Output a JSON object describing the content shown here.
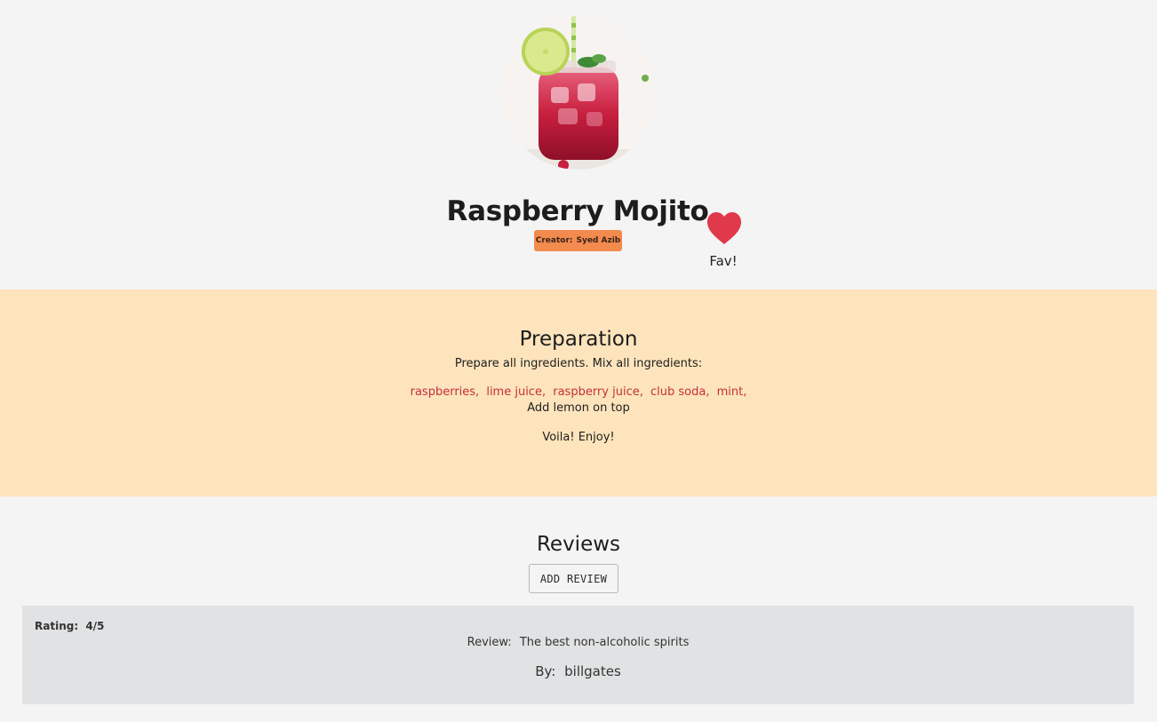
{
  "recipe": {
    "image_alt": "raspberry mojito drink in a jar",
    "title": "Raspberry Mojito",
    "creator_label": "Creator:",
    "creator_name": "Syed Azib",
    "fav_icon": "heart-icon",
    "fav_label": "Fav!"
  },
  "preparation": {
    "heading": "Preparation",
    "intro": "Prepare all ingredients. Mix all ingredients:",
    "ingredients": [
      "raspberries,",
      "lime juice,",
      "raspberry juice,",
      "club soda,",
      "mint,"
    ],
    "step": "Add lemon on top",
    "outro": "Voila! Enjoy!"
  },
  "reviews": {
    "heading": "Reviews",
    "add_button_label": "ADD REVIEW",
    "items": [
      {
        "rating_label": "Rating:",
        "rating_value": "4/5",
        "review_label": "Review:",
        "review_text": "The best non-alcoholic spirits",
        "by_label": "By:",
        "author": "billgates"
      }
    ]
  },
  "colors": {
    "page_background": "#f4f4f4",
    "preparation_background": "#fde4bc",
    "creator_badge": "#f38a4e",
    "heart": "#e0394a",
    "ingredient_text": "#c4303c",
    "review_card": "#e1e2e3"
  }
}
